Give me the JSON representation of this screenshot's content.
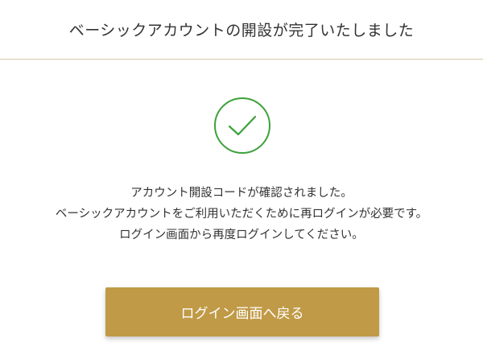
{
  "header": {
    "title": "ベーシックアカウントの開設が完了いたしました"
  },
  "status": {
    "icon": "check-circle-icon",
    "color": "#3da13a"
  },
  "message": {
    "lines": [
      "アカウント開設コードが確認されました。",
      "ベーシックアカウントをご利用いただくために再ログインが必要です。",
      "ログイン画面から再度ログインしてください。"
    ]
  },
  "actions": {
    "back_to_login_label": "ログイン画面へ戻る",
    "button_color": "#c09a46"
  }
}
